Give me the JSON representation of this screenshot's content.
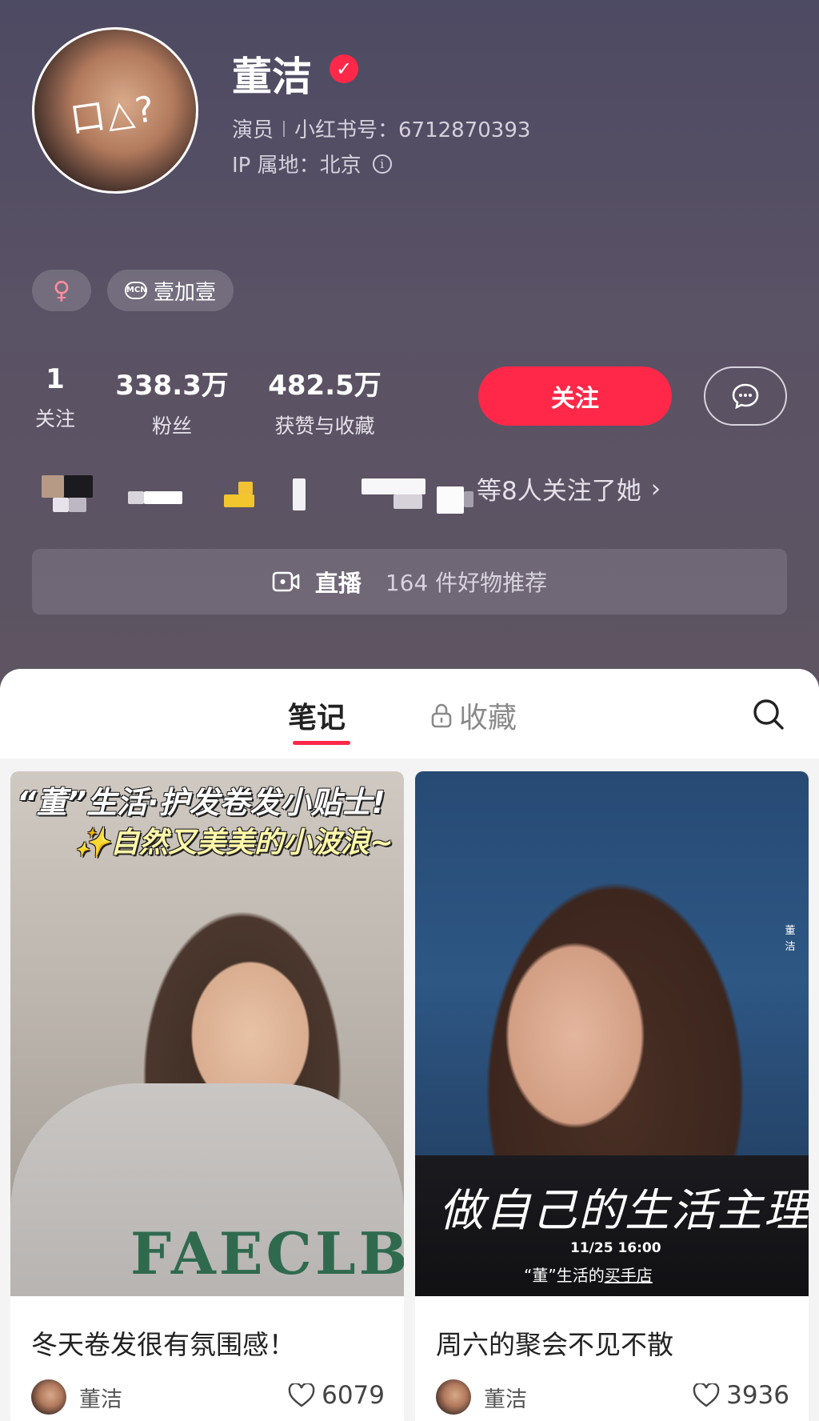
{
  "profile": {
    "name": "董洁",
    "occupation": "演员",
    "red_id": "小红书号：6712870393",
    "ip_location": "IP 属地：北京",
    "avatar_scribble": "口△?",
    "gender_symbol": "♀",
    "mcn_badge": "MCN",
    "mcn_name": "壹加壹"
  },
  "stats": [
    {
      "value": "1",
      "label": "关注"
    },
    {
      "value": "338.3万",
      "label": "粉丝"
    },
    {
      "value": "482.5万",
      "label": "获赞与收藏"
    }
  ],
  "actions": {
    "follow_label": "关注"
  },
  "mutual_followers": {
    "text": "等8人关注了她",
    "arrow": "›"
  },
  "shop_bar": {
    "live_label": "直播",
    "goods_text": "164 件好物推荐"
  },
  "tabs": {
    "notes": "笔记",
    "collections": "收藏"
  },
  "notes": [
    {
      "cover_title_1": "“董”生活·护发卷发小贴士!",
      "cover_title_2": "✨自然又美美的小波浪~",
      "cover_sweater_text": "FAECLB",
      "title": "冬天卷发很有氛围感！",
      "author": "董洁",
      "likes": "6079"
    },
    {
      "cover_vertical": "董洁",
      "cover_script": "做自己的生活主理人",
      "cover_date": "11/25 16:00",
      "cover_shop_prefix": "“董”生活的",
      "cover_shop_link": "买手店",
      "title": "周六的聚会不见不散",
      "author": "董洁",
      "likes": "3936"
    }
  ],
  "colors": {
    "accent": "#ff2848",
    "header_bg": "#544e63"
  }
}
